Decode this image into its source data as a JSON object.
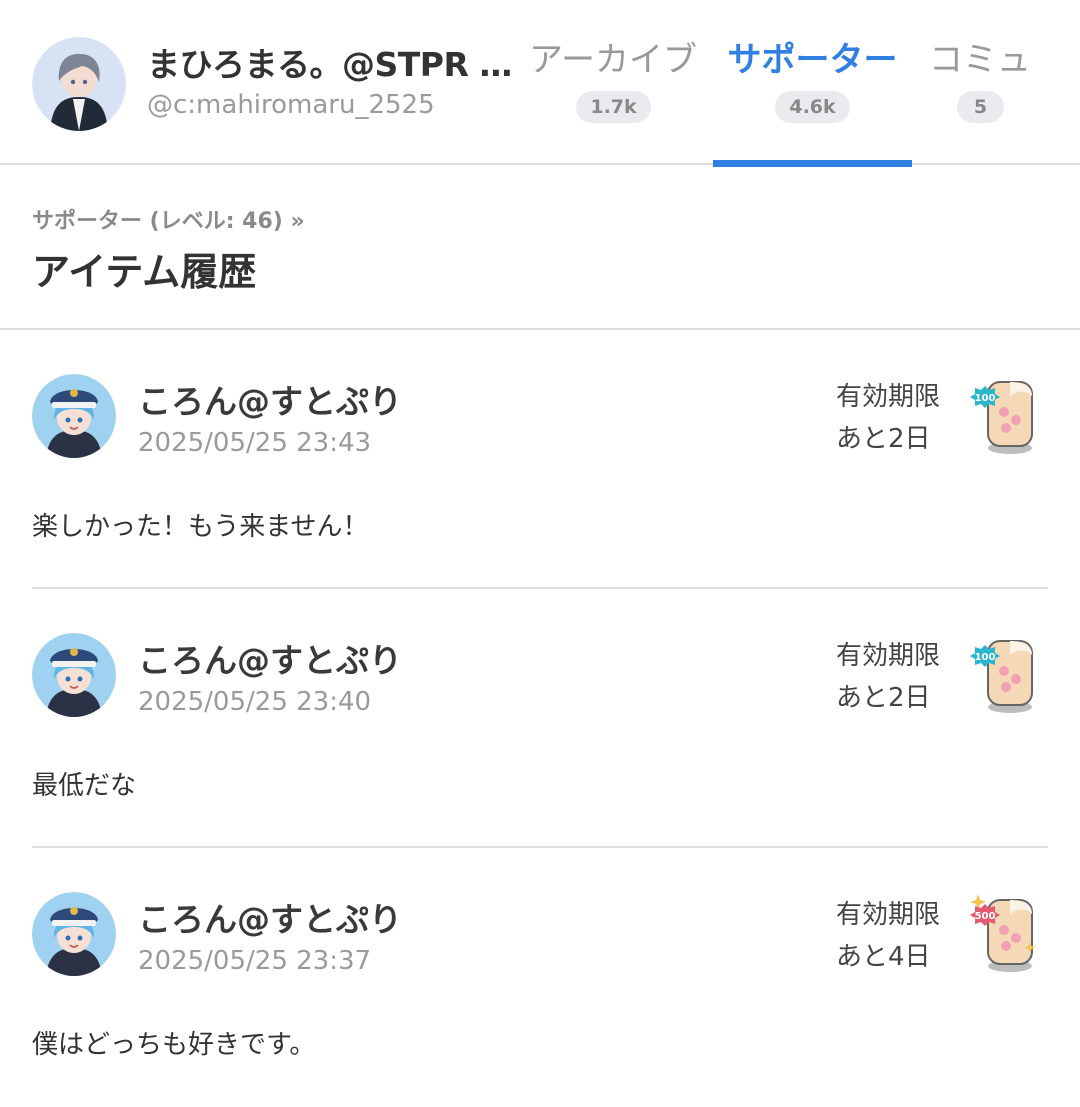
{
  "header": {
    "channel_name": "まひろまる。@STPR …",
    "channel_id": "@c:mahiromaru_2525",
    "tabs": [
      {
        "label": "アーカイブ",
        "count": "1.7k",
        "active": false
      },
      {
        "label": "サポーター",
        "count": "4.6k",
        "active": true
      },
      {
        "label": "コミュ",
        "count": "5",
        "active": false
      }
    ]
  },
  "section": {
    "breadcrumb": "サポーター (レベル: 46)  »",
    "title": "アイテム履歴"
  },
  "items": [
    {
      "user": "ころん@すとぷり",
      "timestamp": "2025/05/25 23:43",
      "expiry_label": "有効期限",
      "expiry_remaining": "あと2日",
      "gift_value": "100",
      "message": "楽しかった！もう来ません！"
    },
    {
      "user": "ころん@すとぷり",
      "timestamp": "2025/05/25 23:40",
      "expiry_label": "有効期限",
      "expiry_remaining": "あと2日",
      "gift_value": "100",
      "message": "最低だな"
    },
    {
      "user": "ころん@すとぷり",
      "timestamp": "2025/05/25 23:37",
      "expiry_label": "有効期限",
      "expiry_remaining": "あと4日",
      "gift_value": "500",
      "message": "僕はどっちも好きです。"
    }
  ],
  "colors": {
    "accent": "#2f80e0",
    "badge_100": "#2bb6cf",
    "badge_500": "#e45a6e",
    "divider": "#dedede"
  }
}
